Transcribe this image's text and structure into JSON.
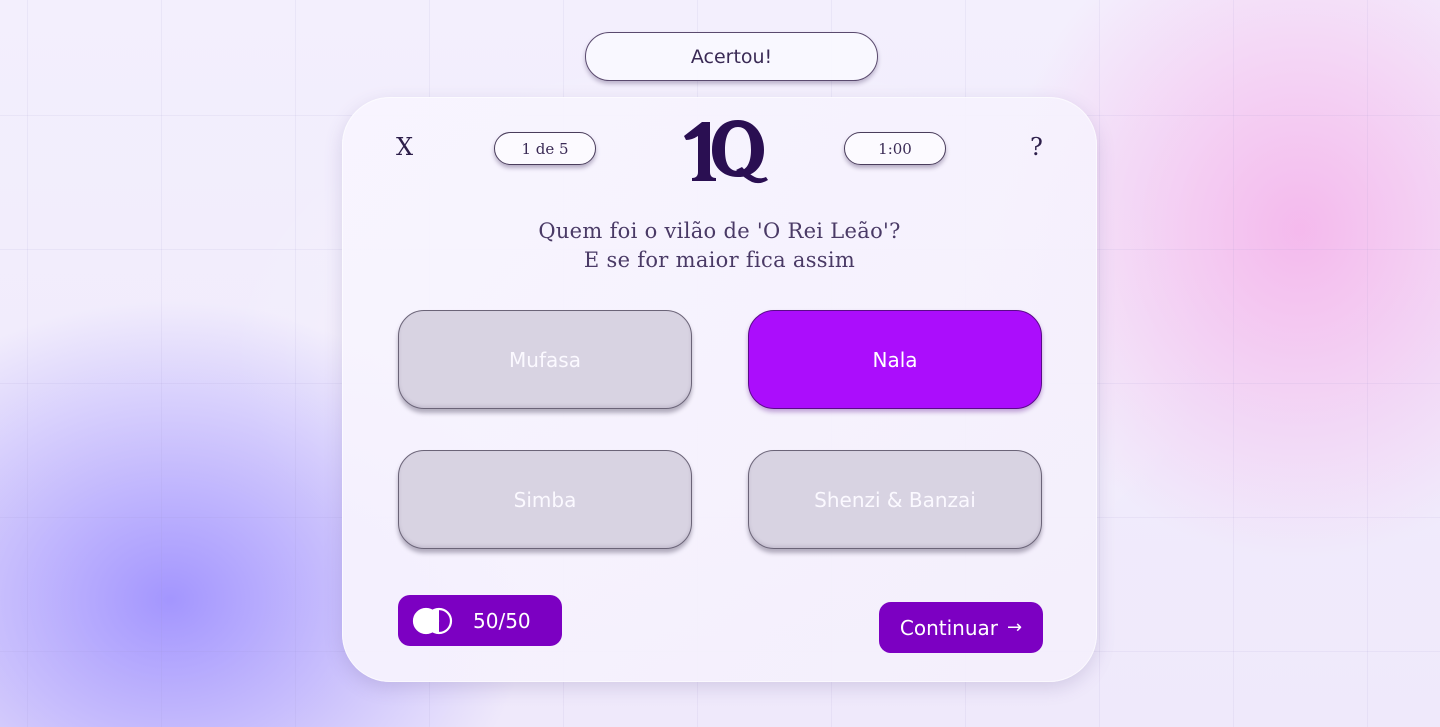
{
  "toast": {
    "text": "Acertou!"
  },
  "header": {
    "close_label": "X",
    "help_label": "?",
    "progress": "1 de 5",
    "timer": "1:00",
    "logo_text": "1Q"
  },
  "question": {
    "line1": "Quem foi o vilão de 'O Rei Leão'?",
    "line2": "E se for maior fica assim"
  },
  "options": [
    {
      "label": "Mufasa",
      "selected": false
    },
    {
      "label": "Nala",
      "selected": true
    },
    {
      "label": "Simba",
      "selected": false
    },
    {
      "label": "Shenzi & Banzai",
      "selected": false
    }
  ],
  "lifeline": {
    "label": "50/50",
    "icon": "half-circle-icon"
  },
  "continue_button": {
    "label": "Continuar",
    "icon": "arrow-right-icon"
  },
  "colors": {
    "accent": "#ab0dfc",
    "button": "#7c00c2",
    "option_default": "#d8d3e2",
    "text_dark": "#2d1e4a"
  }
}
